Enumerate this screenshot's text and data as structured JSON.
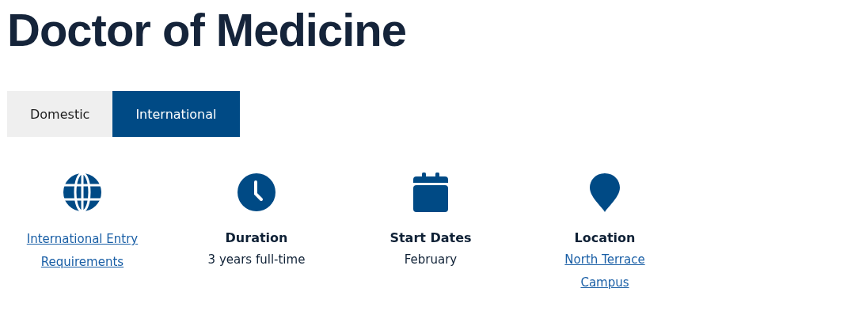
{
  "title": "Doctor of Medicine",
  "tabs": [
    {
      "label": "Domestic",
      "selected": false
    },
    {
      "label": "International",
      "selected": true
    }
  ],
  "facts": [
    {
      "kind": "globe",
      "link": "International Entry Requirements"
    },
    {
      "kind": "clock",
      "heading": "Duration",
      "value": "3 years full-time"
    },
    {
      "kind": "calendar",
      "heading": "Start Dates",
      "value": "February"
    },
    {
      "kind": "pin",
      "heading": "Location",
      "link": "North Terrace Campus"
    }
  ]
}
